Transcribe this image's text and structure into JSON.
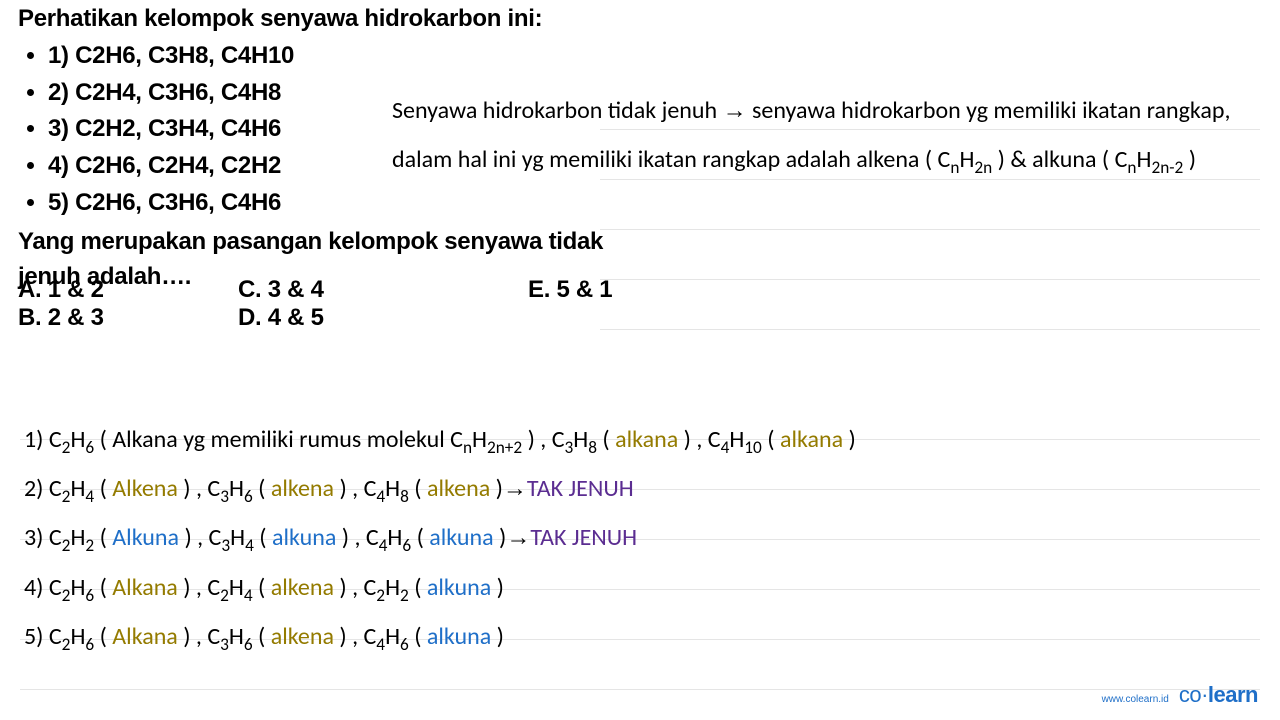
{
  "question": {
    "intro": "Perhatikan kelompok senyawa hidrokarbon ini:",
    "items": [
      "1) C2H6, C3H8, C4H10",
      "2) C2H4, C3H6, C4H8",
      "3) C2H2, C3H4, C4H6",
      "4) C2H6, C2H4, C2H2",
      "5) C2H6, C3H6, C4H6"
    ],
    "prompt": "Yang merupakan pasangan kelompok senyawa tidak jenuh adalah…."
  },
  "options": {
    "A": "A. 1 & 2",
    "B": "B. 2 & 3",
    "C": "C. 3 & 4",
    "D": "D. 4 & 5",
    "E": "E. 5 & 1"
  },
  "note": {
    "full_plain": "Senyawa hidrokarbon tidak jenuh → senyawa hidrokarbon yg memiliki ikatan rangkap, dalam hal ini yg memiliki ikatan rangkap adalah alkena ( CnH2n ) & alkuna ( CnH2n-2 )",
    "part1": "Senyawa hidrokarbon tidak jenuh ",
    "arrow": "→",
    "part2": " senyawa hidrokarbon yg memiliki ikatan rangkap, dalam hal ini yg memiliki ikatan rangkap adalah alkena ( C",
    "sub1": "n",
    "part3": "H",
    "sub2": "2n",
    "part4": " ) & alkuna ( C",
    "sub3": "n",
    "part5": "H",
    "sub4": "2n-2",
    "part6": " )"
  },
  "analysis": {
    "lines_plain": [
      "1) C2H6 ( Alkana yg memiliki rumus molekul CnH2n+2 ) , C3H8 ( alkana ) , C4H10 ( alkana )",
      "2) C2H4 ( Alkena ) , C3H6 ( alkena ) , C4H8 ( alkena ) → TAK JENUH",
      "3) C2H2 ( Alkuna ) , C3H4 ( alkuna ) , C4H6 ( alkuna ) → TAK JENUH",
      "4) C2H6 ( Alkana ) , C2H4 ( alkena ) , C2H2 ( alkuna )",
      "5) C2H6 ( Alkana ) , C3H6 ( alkena ) , C4H6 ( alkuna )"
    ],
    "words": {
      "alkana": "alkana",
      "Alkana": "Alkana",
      "alkena": "alkena",
      "Alkena": "Alkena",
      "alkuna": "alkuna",
      "Alkuna": "Alkuna",
      "takjenuh": "TAK JENUH",
      "line1_pre": "1) C",
      "line1_a": " ( Alkana yg memiliki rumus molekul C",
      "line1_b": " ) , C",
      "line1_c": " ( ",
      "line1_d": " ) , C",
      "line1_e": " ( ",
      "line1_f": " )",
      "line2_pre": "2) C",
      "line3_pre": "3) C",
      "line4_pre": "4) C",
      "line5_pre": "5) C",
      "gen_b": " ( ",
      "gen_c": " ) , C",
      "gen_d": " ( ",
      "gen_e": " ) , C",
      "gen_f": " ( ",
      "gen_g": " )",
      "arrow_sp": " → "
    },
    "sub": {
      "n": "n",
      "2": "2",
      "3": "3",
      "4": "4",
      "6": "6",
      "8": "8",
      "10": "10",
      "2n": "2n",
      "2n2": "2n+2"
    },
    "H": "H"
  },
  "footer": {
    "url": "www.colearn.id",
    "brand_a": "co",
    "brand_dot": "·",
    "brand_b": "learn"
  }
}
